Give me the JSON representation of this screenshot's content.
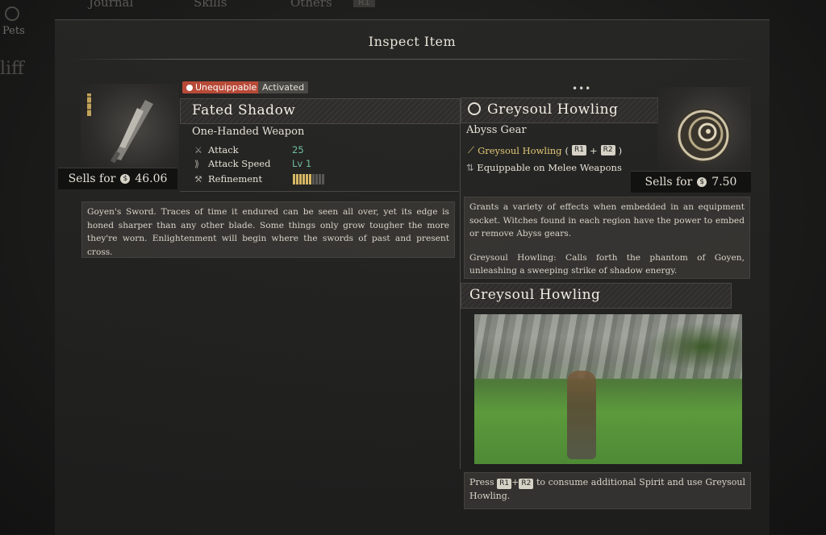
{
  "nav": {
    "tabs": [
      "Journal",
      "Skills",
      "Others"
    ],
    "key_hint": "R1",
    "side_pets": "Pets",
    "side_partial": "liff"
  },
  "panel": {
    "title": "Inspect Item"
  },
  "left_item": {
    "badges": {
      "unequippable": "Unequippable",
      "activated": "Activated"
    },
    "name": "Fated Shadow",
    "type": "One-Handed Weapon",
    "stats": [
      {
        "label": "Attack",
        "value": "25",
        "icon": "sword-icon"
      },
      {
        "label": "Attack Speed",
        "value": "Lv 1",
        "icon": "speed-icon"
      },
      {
        "label": "Refinement",
        "icon": "anvil-icon"
      }
    ],
    "refinement_level": 0.6,
    "refinement_segments": 10,
    "sells_label": "Sells for",
    "sells_value": "46.06",
    "description": "Goyen's Sword. Traces of time it endured can be seen all over, yet its edge is honed sharper than any other blade. Some things only grow tougher the more they're worn. Enlightenment will begin where the swords of past and present cross."
  },
  "right_item": {
    "more": "•••",
    "name": "Greysoul Howling",
    "type": "Abyss Gear",
    "skill_name": "Greysoul Howling",
    "skill_keys": [
      "R1",
      "R2"
    ],
    "equip_text": "Equippable on Melee Weapons",
    "sells_label": "Sells for",
    "sells_value": "7.50",
    "description_1": "Grants a variety of effects when embedded in an equipment socket. Witches found in each region have the power to embed or remove Abyss gears.",
    "description_2": "Greysoul Howling: Calls forth the phantom of Goyen, unleashing a sweeping strike of shadow energy.",
    "skill_section_title": "Greysoul Howling",
    "press_prefix": "Press",
    "press_keys": [
      "R1",
      "R2"
    ],
    "press_suffix": "to consume additional Spirit and use Greysoul Howling."
  },
  "colors": {
    "badge_red": "#b84a38",
    "stat_value": "#6fbf9a",
    "skill_gold": "#e2c777",
    "refine_gold": "#d7b765"
  }
}
